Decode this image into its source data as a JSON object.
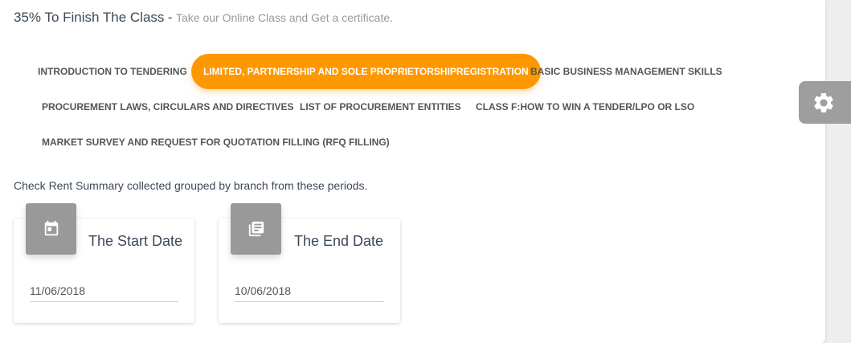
{
  "header": {
    "title": "35% To Finish The Class",
    "separator": "-",
    "subtitle": "Take our Online Class and Get a certificate."
  },
  "tabs": [
    {
      "label": "INTRODUCTION TO TENDERING",
      "active": false
    },
    {
      "label": "LIMITED, PARTNERSHIP AND SOLE PROPRIETORSHIPREGISTRATION",
      "active": true
    },
    {
      "label": "BASIC BUSINESS MANAGEMENT SKILLS",
      "active": false
    },
    {
      "label": "PROCUREMENT LAWS, CIRCULARS AND DIRECTIVES",
      "active": false
    },
    {
      "label": "LIST OF PROCUREMENT ENTITIES",
      "active": false
    },
    {
      "label": "CLASS F:HOW TO WIN A TENDER/LPO OR LSO",
      "active": false
    },
    {
      "label": "MARKET SURVEY AND REQUEST FOR QUOTATION FILLING (RFQ FILLING)",
      "active": false
    }
  ],
  "note": "Check Rent Summary collected grouped by branch from these periods.",
  "start_card": {
    "icon": "calendar-icon",
    "title": "The Start Date",
    "value": "11/06/2018"
  },
  "end_card": {
    "icon": "library-books-icon",
    "title": "The End Date",
    "value": "10/06/2018"
  },
  "settings": {
    "icon": "gear-icon"
  },
  "colors": {
    "accent": "#ff9800",
    "icon_box": "#999999",
    "settings_bg": "#9e9e9e"
  }
}
